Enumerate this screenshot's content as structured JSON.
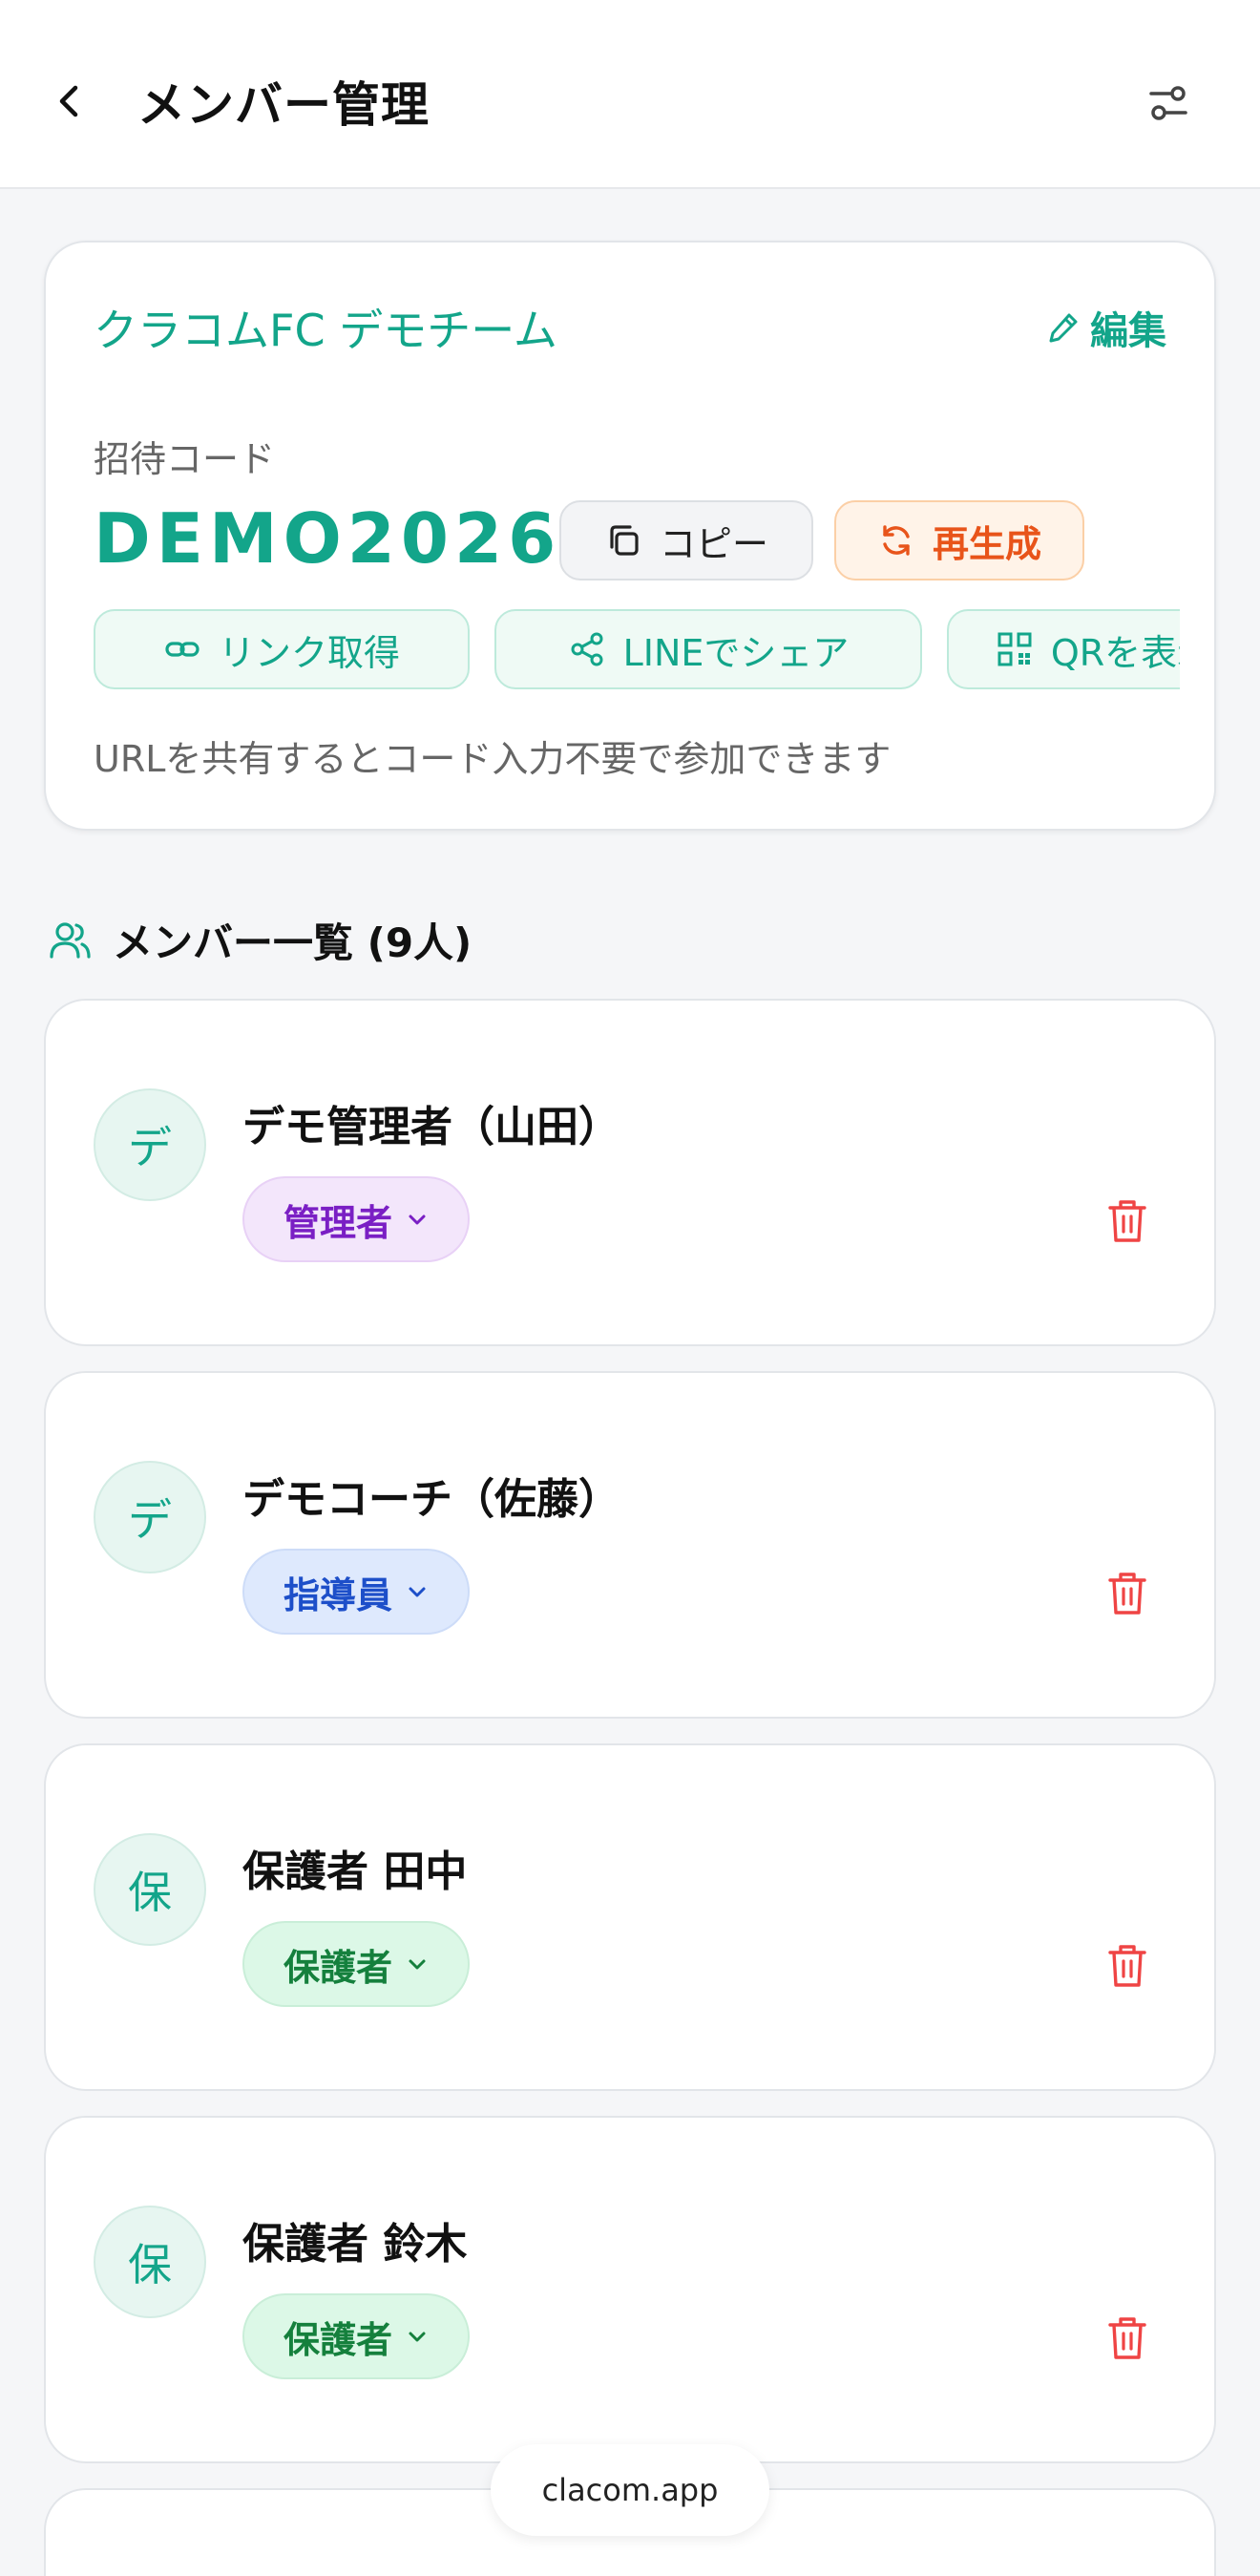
{
  "header": {
    "title": "メンバー管理",
    "back_icon": "chevron-left-icon",
    "settings_icon": "sliders-icon"
  },
  "invite": {
    "team_name": "クラコムFC デモチーム",
    "edit_label": "編集",
    "code_label": "招待コード",
    "code": "DEMO2026",
    "copy_label": "コピー",
    "regenerate_label": "再生成",
    "share_buttons": [
      {
        "label": "リンク取得",
        "icon": "link-icon"
      },
      {
        "label": "LINEでシェア",
        "icon": "share-icon"
      },
      {
        "label": "QRを表示",
        "icon": "qr-code-icon"
      }
    ],
    "hint": "URLを共有するとコード入力不要で参加できます"
  },
  "members": {
    "heading": "メンバー一覧 (9人)",
    "items": [
      {
        "initial": "デ",
        "name": "デモ管理者（山田）",
        "role": "管理者",
        "role_type": "admin"
      },
      {
        "initial": "デ",
        "name": "デモコーチ（佐藤）",
        "role": "指導員",
        "role_type": "coach"
      },
      {
        "initial": "保",
        "name": "保護者 田中",
        "role": "保護者",
        "role_type": "guardian"
      },
      {
        "initial": "保",
        "name": "保護者 鈴木",
        "role": "保護者",
        "role_type": "guardian"
      }
    ]
  },
  "footer": {
    "url": "clacom.app"
  },
  "colors": {
    "accent": "#13a58a",
    "danger": "#ef4444",
    "regen": "#e8541a"
  }
}
